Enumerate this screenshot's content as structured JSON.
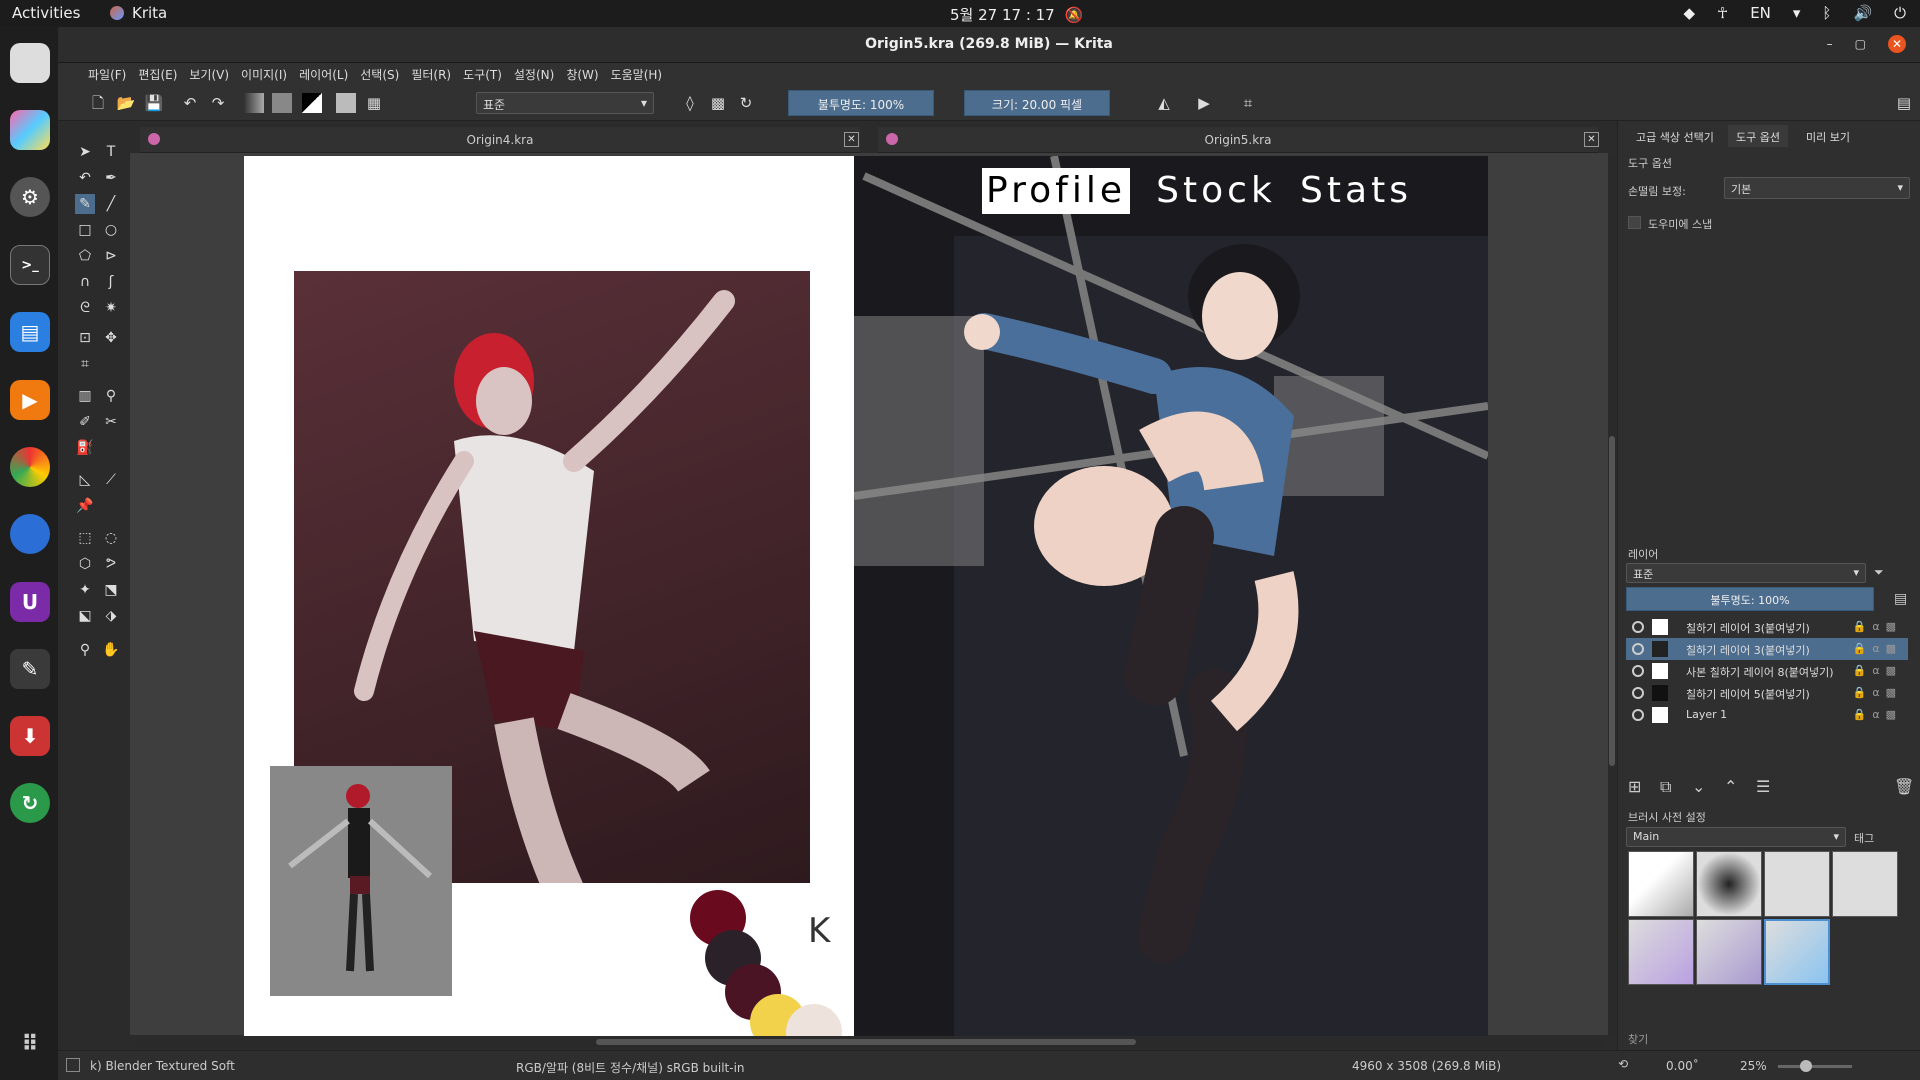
{
  "system": {
    "activities": "Activities",
    "app_name": "Krita",
    "clock": "5월 27  17 : 17",
    "lang": "EN"
  },
  "window": {
    "title": "Origin5.kra (269.8 MiB) — Krita"
  },
  "menu": [
    "파일(F)",
    "편집(E)",
    "보기(V)",
    "이미지(I)",
    "레이어(L)",
    "선택(S)",
    "필터(R)",
    "도구(T)",
    "설정(N)",
    "창(W)",
    "도움말(H)"
  ],
  "toolbar": {
    "blend_mode": "표준",
    "opacity": "불투명도: 100%",
    "size": "크기: 20.00 픽셀"
  },
  "docs": [
    {
      "name": "Origin4.kra"
    },
    {
      "name": "Origin5.kra"
    }
  ],
  "artwork": {
    "menu_items": [
      "Profile",
      "Stock",
      "Stats"
    ],
    "signature": "K"
  },
  "dockers": {
    "tabs": [
      "고급 색상 선택기",
      "도구 옵션",
      "미리 보기"
    ],
    "tool_options": {
      "title": "도구 옵션",
      "smoothing_label": "손떨림 보정:",
      "smoothing_value": "기본",
      "snap_label": "도우미에 스냅"
    },
    "layers": {
      "title": "레이어",
      "blend": "표준",
      "opacity": "불투명도: 100%",
      "items": [
        "칠하기 레이어 3(붙여넣기)",
        "칠하기 레이어 3(붙여넣기)",
        "사본 칠하기 레이어 8(붙여넣기)",
        "칠하기 레이어 5(붙여넣기)",
        "Layer 1"
      ],
      "selected_index": 1
    },
    "brushes": {
      "title": "브러시 사전 설정",
      "preset_group": "Main",
      "tag_button": "태그",
      "search_label": "찾기"
    }
  },
  "status": {
    "brush": "k) Blender Textured Soft",
    "color": "RGB/알파 (8비트 정수/채널)  sRGB built-in",
    "dimensions": "4960 x 3508 (269.8 MiB)",
    "rotation": "0.00˚",
    "zoom": "25%"
  }
}
